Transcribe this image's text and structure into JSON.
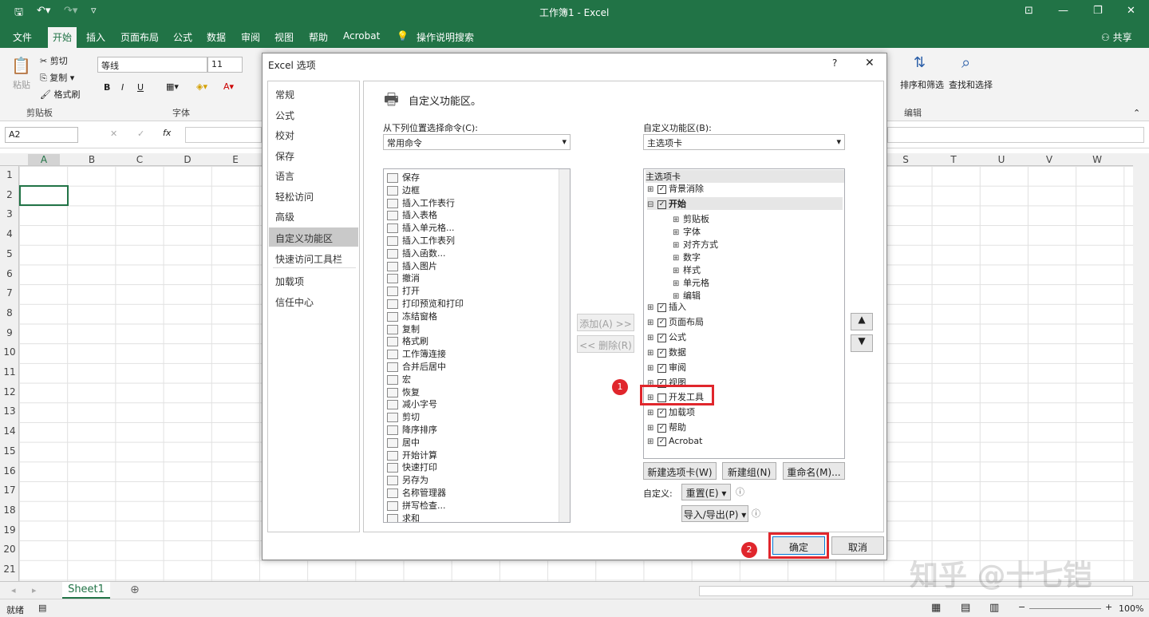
{
  "window": {
    "title": "工作簿1  -  Excel",
    "share_label": "共享"
  },
  "ribbon_tabs": [
    "文件",
    "开始",
    "插入",
    "页面布局",
    "公式",
    "数据",
    "审阅",
    "视图",
    "帮助",
    "Acrobat"
  ],
  "tell_me": "操作说明搜索",
  "clipboard": {
    "paste": "粘贴",
    "cut": "剪切",
    "copy": "复制",
    "format_painter": "格式刷",
    "group": "剪贴板"
  },
  "font": {
    "name": "等线",
    "size": "11",
    "group": "字体",
    "bold": "B",
    "italic": "I",
    "underline": "U"
  },
  "editing": {
    "sort_filter": "排序和筛选",
    "find_select": "查找和选择",
    "group": "编辑"
  },
  "namebox": "A2",
  "formula_icons": {
    "cancel": "✕",
    "enter": "✓",
    "fx": "fx"
  },
  "columns_left": [
    "A",
    "B",
    "C",
    "D",
    "E"
  ],
  "columns_right": [
    "S",
    "T",
    "U",
    "V",
    "W"
  ],
  "rows": [
    "1",
    "2",
    "3",
    "4",
    "5",
    "6",
    "7",
    "8",
    "9",
    "10",
    "11",
    "12",
    "13",
    "14",
    "15",
    "16",
    "17",
    "18",
    "19",
    "20",
    "21"
  ],
  "sheet_tab": "Sheet1",
  "status": {
    "ready": "就绪",
    "zoom": "100%"
  },
  "dialog": {
    "title": "Excel 选项",
    "help": "?",
    "close": "✕",
    "nav": [
      "常规",
      "公式",
      "校对",
      "保存",
      "语言",
      "轻松访问",
      "高级",
      "自定义功能区",
      "快速访问工具栏",
      "加载项",
      "信任中心"
    ],
    "selected_nav": "自定义功能区",
    "heading": "自定义功能区。",
    "choose_label": "从下列位置选择命令(C):",
    "choose_value": "常用命令",
    "customize_label": "自定义功能区(B):",
    "customize_value": "主选项卡",
    "commands": [
      "保存",
      "边框",
      "插入工作表行",
      "插入表格",
      "插入单元格...",
      "插入工作表列",
      "插入函数...",
      "插入图片",
      "撤消",
      "打开",
      "打印预览和打印",
      "冻结窗格",
      "复制",
      "格式刷",
      "工作簿连接",
      "合并后居中",
      "宏",
      "恢复",
      "减小字号",
      "剪切",
      "降序排序",
      "居中",
      "开始计算",
      "快速打印",
      "另存为",
      "名称管理器",
      "拼写检查...",
      "求和"
    ],
    "add_btn": "添加(A) >>",
    "remove_btn": "<< 删除(R)",
    "tree_header": "主选项卡",
    "tree": [
      {
        "label": "背景消除",
        "checked": true,
        "level": 0
      },
      {
        "label": "开始",
        "checked": true,
        "level": 0,
        "expanded": true
      },
      {
        "label": "剪贴板",
        "level": 1
      },
      {
        "label": "字体",
        "level": 1
      },
      {
        "label": "对齐方式",
        "level": 1
      },
      {
        "label": "数字",
        "level": 1
      },
      {
        "label": "样式",
        "level": 1
      },
      {
        "label": "单元格",
        "level": 1
      },
      {
        "label": "编辑",
        "level": 1
      },
      {
        "label": "插入",
        "checked": true,
        "level": 0
      },
      {
        "label": "页面布局",
        "checked": true,
        "level": 0
      },
      {
        "label": "公式",
        "checked": true,
        "level": 0
      },
      {
        "label": "数据",
        "checked": true,
        "level": 0
      },
      {
        "label": "审阅",
        "checked": true,
        "level": 0
      },
      {
        "label": "视图",
        "checked": true,
        "level": 0
      },
      {
        "label": "开发工具",
        "checked": false,
        "level": 0
      },
      {
        "label": "加载项",
        "checked": true,
        "level": 0
      },
      {
        "label": "帮助",
        "checked": true,
        "level": 0
      },
      {
        "label": "Acrobat",
        "checked": true,
        "level": 0
      }
    ],
    "new_tab_btn": "新建选项卡(W)",
    "new_group_btn": "新建组(N)",
    "rename_btn": "重命名(M)...",
    "customize_text": "自定义:",
    "reset_btn": "重置(E) ▾",
    "import_export_btn": "导入/导出(P) ▾",
    "ok_btn": "确定",
    "cancel_btn": "取消",
    "step1": "1",
    "step2": "2"
  },
  "watermark": "知乎 @十七铠",
  "accent_color": "#217346",
  "highlight_color": "#e0262c"
}
